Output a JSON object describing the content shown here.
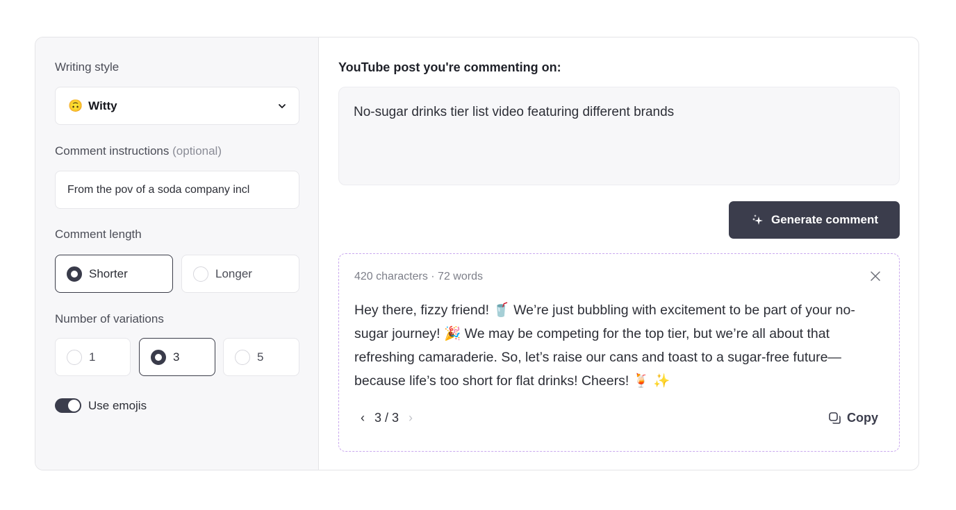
{
  "sidebar": {
    "writing_style": {
      "label": "Writing style",
      "selected_emoji": "🙃",
      "selected_value": "Witty",
      "chevron_icon": "chevron-down-icon"
    },
    "instructions": {
      "label": "Comment instructions",
      "label_optional": "(optional)",
      "value": "From the pov of a soda company incl"
    },
    "length": {
      "label": "Comment length",
      "options": [
        {
          "label": "Shorter",
          "selected": true
        },
        {
          "label": "Longer",
          "selected": false
        }
      ]
    },
    "variations": {
      "label": "Number of variations",
      "options": [
        {
          "label": "1",
          "selected": false
        },
        {
          "label": "3",
          "selected": true
        },
        {
          "label": "5",
          "selected": false
        }
      ]
    },
    "emojis_toggle": {
      "label": "Use emojis",
      "on": true
    }
  },
  "main": {
    "post_label": "YouTube post you're commenting on:",
    "post_value": "No-sugar drinks tier list video featuring different brands",
    "generate_button": {
      "label": "Generate comment",
      "icon": "sparkles-icon"
    },
    "result": {
      "meta": "420 characters · 72 words",
      "text": "Hey there, fizzy friend! 🥤 We’re just bubbling with excitement to be part of your no-sugar journey! 🎉 We may be competing for the top tier, but we’re all about that refreshing camaraderie. So, let’s raise our cans and toast to a sugar-free future—because life’s too short for flat drinks! Cheers! 🍹 ✨",
      "pager": {
        "prev": "‹",
        "current": "3 / 3",
        "next": "›"
      },
      "copy_label": "Copy"
    }
  },
  "colors": {
    "accent_dark": "#3b3d4c",
    "dashed_border": "#c9a8ee",
    "sidebar_bg": "#f7f7f9"
  }
}
